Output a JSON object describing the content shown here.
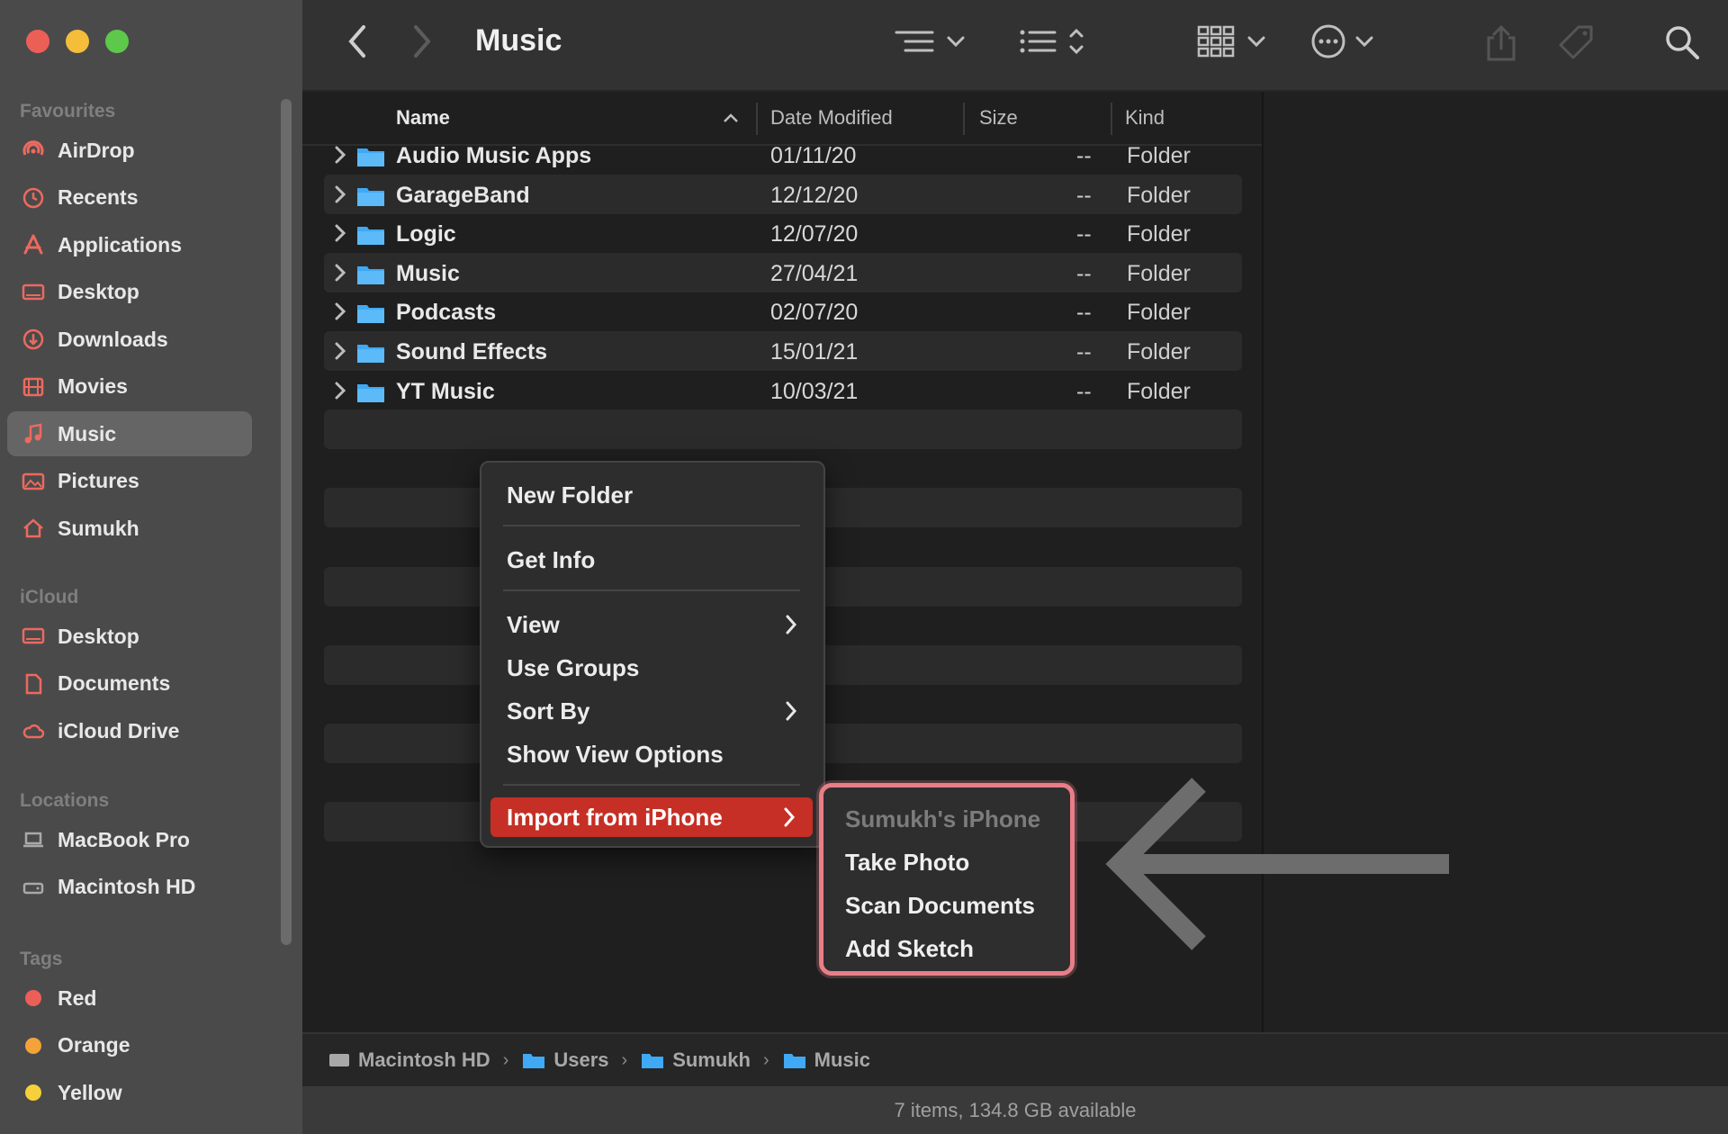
{
  "window": {
    "title": "Music"
  },
  "colors": {
    "close": "#ec5f57",
    "minimize": "#f4bd3a",
    "zoom": "#5ec84b",
    "accent": "#c62f25",
    "folder": "#3fa9f5",
    "highlight_border": "#e77e88"
  },
  "sidebar": {
    "favourites_label": "Favourites",
    "favourites": [
      {
        "label": "AirDrop",
        "icon": "airdrop-icon"
      },
      {
        "label": "Recents",
        "icon": "clock-icon"
      },
      {
        "label": "Applications",
        "icon": "applications-icon"
      },
      {
        "label": "Desktop",
        "icon": "desktop-icon"
      },
      {
        "label": "Downloads",
        "icon": "downloads-icon"
      },
      {
        "label": "Movies",
        "icon": "film-icon"
      },
      {
        "label": "Music",
        "icon": "music-note-icon",
        "active": true
      },
      {
        "label": "Pictures",
        "icon": "photo-icon"
      },
      {
        "label": "Sumukh",
        "icon": "home-icon"
      }
    ],
    "icloud_label": "iCloud",
    "icloud": [
      {
        "label": "Desktop",
        "icon": "desktop-icon"
      },
      {
        "label": "Documents",
        "icon": "document-icon"
      },
      {
        "label": "iCloud Drive",
        "icon": "cloud-icon"
      }
    ],
    "locations_label": "Locations",
    "locations": [
      {
        "label": "MacBook Pro",
        "icon": "laptop-icon"
      },
      {
        "label": "Macintosh HD",
        "icon": "drive-icon"
      }
    ],
    "tags_label": "Tags",
    "tags": [
      {
        "label": "Red",
        "color": "#ec5f57"
      },
      {
        "label": "Orange",
        "color": "#f4a23a"
      },
      {
        "label": "Yellow",
        "color": "#f5d03b"
      }
    ]
  },
  "columns": {
    "name": "Name",
    "date": "Date Modified",
    "size": "Size",
    "kind": "Kind"
  },
  "files": [
    {
      "name": "Audio Music Apps",
      "date": "01/11/20",
      "size": "--",
      "kind": "Folder"
    },
    {
      "name": "GarageBand",
      "date": "12/12/20",
      "size": "--",
      "kind": "Folder"
    },
    {
      "name": "Logic",
      "date": "12/07/20",
      "size": "--",
      "kind": "Folder"
    },
    {
      "name": "Music",
      "date": "27/04/21",
      "size": "--",
      "kind": "Folder"
    },
    {
      "name": "Podcasts",
      "date": "02/07/20",
      "size": "--",
      "kind": "Folder"
    },
    {
      "name": "Sound Effects",
      "date": "15/01/21",
      "size": "--",
      "kind": "Folder"
    },
    {
      "name": "YT Music",
      "date": "10/03/21",
      "size": "--",
      "kind": "Folder"
    }
  ],
  "context_menu": {
    "new_folder": "New Folder",
    "get_info": "Get Info",
    "view": "View",
    "use_groups": "Use Groups",
    "sort_by": "Sort By",
    "show_view_options": "Show View Options",
    "import_from_iphone": "Import from iPhone"
  },
  "submenu": {
    "device": "Sumukh's iPhone",
    "take_photo": "Take Photo",
    "scan_documents": "Scan Documents",
    "add_sketch": "Add Sketch"
  },
  "pathbar": [
    "Macintosh HD",
    "Users",
    "Sumukh",
    "Music"
  ],
  "status": "7 items, 134.8 GB available"
}
